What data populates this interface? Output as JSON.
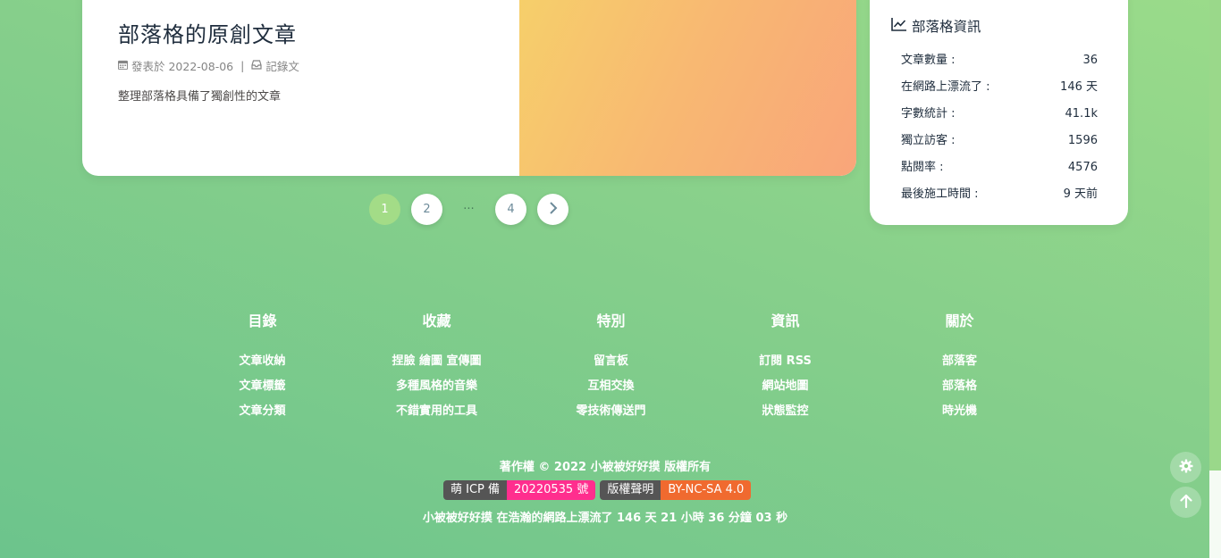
{
  "post": {
    "title": "部落格的原創文章",
    "date_label": "發表於 2022-08-06",
    "separator": "|",
    "category": "記錄文",
    "description": "整理部落格具備了獨創性的文章"
  },
  "pagination": {
    "current": "1",
    "page2": "2",
    "dots": "···",
    "last": "4",
    "next_icon": "chevron-right-icon"
  },
  "widget": {
    "title": "部落格資訊",
    "icon": "chart-line-icon",
    "rows": [
      {
        "label": "文章數量 :",
        "value": "36"
      },
      {
        "label": "在網路上漂流了 :",
        "value": "146 天"
      },
      {
        "label": "字數統計 :",
        "value": "41.1k"
      },
      {
        "label": "獨立訪客 :",
        "value": "1596"
      },
      {
        "label": "點閱率 :",
        "value": "4576"
      },
      {
        "label": "最後施工時間 :",
        "value": "9 天前"
      }
    ]
  },
  "footer": {
    "columns": [
      {
        "title": "目錄",
        "links": [
          "文章收納",
          "文章標籤",
          "文章分類"
        ]
      },
      {
        "title": "收藏",
        "links": [
          "捏臉 繪圖 宣傳圖",
          "多種風格的音樂",
          "不錯實用的工具"
        ]
      },
      {
        "title": "特別",
        "links": [
          "留言板",
          "互相交換",
          "零技術傳送門"
        ]
      },
      {
        "title": "資訊",
        "links": [
          "訂閱 RSS",
          "網站地圖",
          "狀態監控"
        ]
      },
      {
        "title": "關於",
        "links": [
          "部落客",
          "部落格",
          "時光機"
        ]
      }
    ],
    "copyright": "著作權 © 2022 小被被好好摸 版權所有",
    "badge_icp_label": "萌 ICP 備",
    "badge_icp_value": "20220535 號",
    "badge_license_label": "版權聲明",
    "badge_license_value": "BY-NC-SA 4.0",
    "runtime": "小被被好好摸 在浩瀚的網路上漂流了 146 天 21 小時 36 分鐘 03 秒"
  },
  "floating": {
    "settings_icon": "gear-icon",
    "top_icon": "arrow-up-icon"
  },
  "colors": {
    "accent": "#a3dc87",
    "badge_pink": "#ff2e8e",
    "badge_orange": "#f06a2f"
  }
}
